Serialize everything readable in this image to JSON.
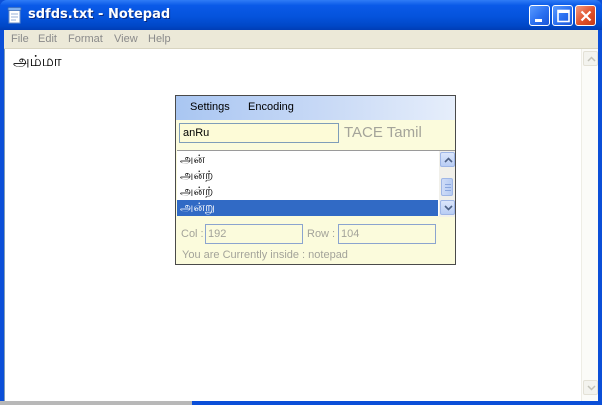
{
  "window": {
    "title": "sdfds.txt - Notepad",
    "icon": "notepad-icon",
    "controls": [
      "minimize-icon",
      "maximize-icon",
      "close-icon"
    ]
  },
  "menu": {
    "items": [
      "File",
      "Edit",
      "Format",
      "View",
      "Help"
    ]
  },
  "editor": {
    "content": "அம்மா"
  },
  "ime": {
    "menu": [
      "Settings",
      "Encoding"
    ],
    "input_value": "anRu",
    "brand": "TACE Tamil",
    "candidates": [
      {
        "text": "அன்",
        "selected": false
      },
      {
        "text": "அன்ற்",
        "selected": false
      },
      {
        "text": "அன்ற்",
        "selected": false
      },
      {
        "text": "அன்று",
        "selected": true
      }
    ],
    "col_label": "Col :",
    "col_value": "192",
    "row_label": "Row :",
    "row_value": "104",
    "status": "You are Currently inside : notepad"
  },
  "colors": {
    "titlebar": "#0553dc",
    "selection": "#316ac5",
    "ime_background": "#fbfbdc"
  }
}
